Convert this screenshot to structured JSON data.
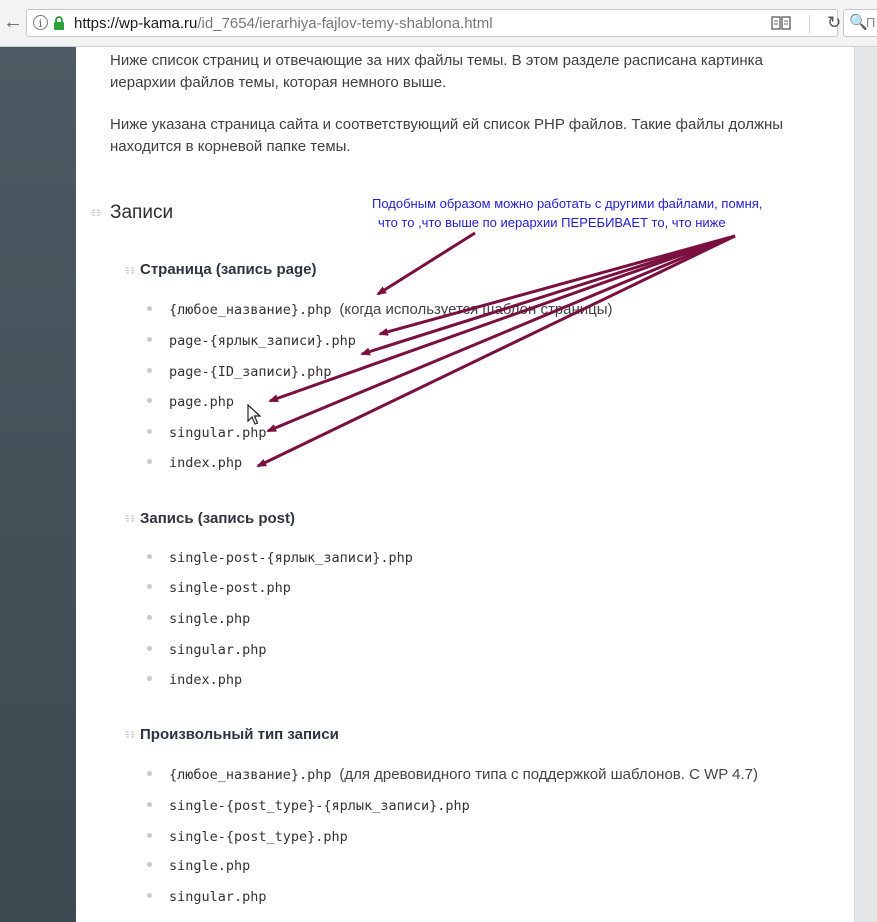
{
  "browser": {
    "back_glyph": "←",
    "info_glyph": "i",
    "url_host": "https://wp-kama.ru",
    "url_path": "/id_7654/ierarhiya-fajlov-temy-shablona.html",
    "reload_glyph": "↻",
    "search_glyph": "🔍",
    "search_placeholder": "П"
  },
  "intro": {
    "p1_line1": "Ниже список страниц и отвечающие за них файлы темы. В этом разделе расписана картинка",
    "p1_line2": "иерархии файлов темы, которая немного выше.",
    "p2_line1": "Ниже указана страница сайта и соответствующий ей список PHP файлов. Такие файлы должны",
    "p2_line2": "находится в корневой папке темы."
  },
  "section_title": "Записи",
  "annotation": {
    "line1": "Подобным образом можно работать с другими файлами, помня,",
    "line2": "что то ,что выше по иерархии ПЕРЕБИВАЕТ то, что ниже",
    "color": "#2222cc",
    "arrow_color": "#7a1040"
  },
  "groups": [
    {
      "title": "Страница (запись page)",
      "items": [
        {
          "code": "{любое_название}.php",
          "note": "(когда используется шаблон страницы)"
        },
        {
          "code": "page-{ярлык_записи}.php",
          "note": ""
        },
        {
          "code": "page-{ID_записи}.php",
          "note": ""
        },
        {
          "code": "page.php",
          "note": ""
        },
        {
          "code": "singular.php",
          "note": ""
        },
        {
          "code": "index.php",
          "note": ""
        }
      ]
    },
    {
      "title": "Запись (запись post)",
      "items": [
        {
          "code": "single-post-{ярлык_записи}.php",
          "note": ""
        },
        {
          "code": "single-post.php",
          "note": ""
        },
        {
          "code": "single.php",
          "note": ""
        },
        {
          "code": "singular.php",
          "note": ""
        },
        {
          "code": "index.php",
          "note": ""
        }
      ]
    },
    {
      "title": "Произвольный тип записи",
      "items": [
        {
          "code": "{любое_название}.php",
          "note": "(для древовидного типа с поддержкой шаблонов. С WP 4.7)"
        },
        {
          "code": "single-{post_type}-{ярлык_записи}.php",
          "note": ""
        },
        {
          "code": "single-{post_type}.php",
          "note": ""
        },
        {
          "code": "single.php",
          "note": ""
        },
        {
          "code": "singular.php",
          "note": ""
        }
      ]
    }
  ]
}
